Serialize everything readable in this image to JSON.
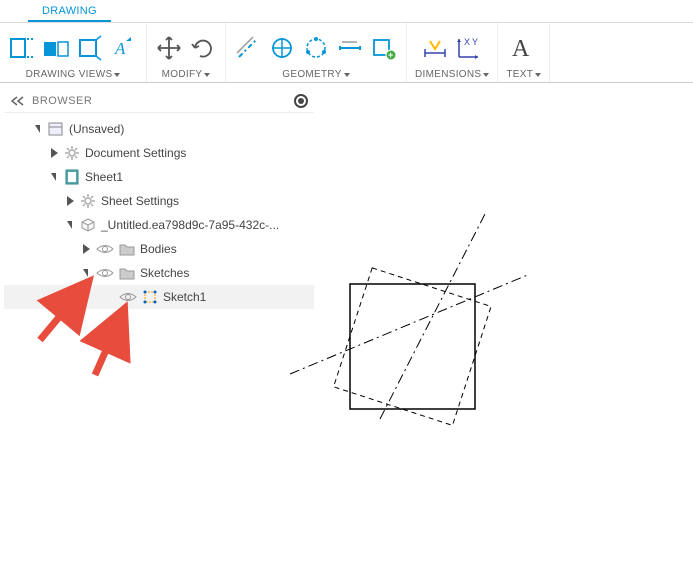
{
  "ribbon": {
    "tab": "DRAWING",
    "groups": {
      "views": "DRAWING VIEWS",
      "modify": "MODIFY",
      "geometry": "GEOMETRY",
      "dimensions": "DIMENSIONS",
      "text": "TEXT"
    }
  },
  "browser": {
    "title": "BROWSER",
    "root": "(Unsaved)",
    "docSettings": "Document Settings",
    "sheet": "Sheet1",
    "sheetSettings": "Sheet Settings",
    "untitled": "_Untitled.ea798d9c-7a95-432c-...",
    "bodies": "Bodies",
    "sketches": "Sketches",
    "sketch1": "Sketch1"
  }
}
